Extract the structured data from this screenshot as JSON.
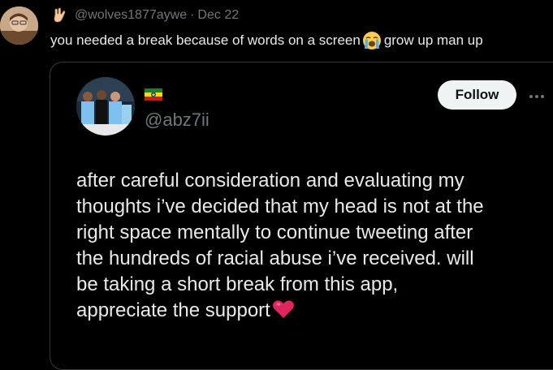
{
  "reply": {
    "avatar": "profile-avatar",
    "badge_icon": "hand-gesture-icon",
    "handle": "@wolves1877aywe",
    "separator": "·",
    "date": "Dec 22",
    "text_before": "you needed a break because of words on a screen",
    "emoji": "loudly-crying-face-icon",
    "text_after": "grow up man up"
  },
  "quote": {
    "avatar": "football-players-avatar",
    "flag_icon": "ethiopia-flag-icon",
    "handle": "@abz7ii",
    "follow_label": "Follow",
    "more_icon": "more-options-icon",
    "text_lines": [
      "after careful consideration and evaluating my",
      "thoughts i’ve decided that my head is not at the",
      "right space mentally to continue tweeting after",
      "the hundreds of racial abuse i’ve received. will",
      "be taking a short break from this app,",
      "appreciate the support"
    ],
    "end_emoji": "red-heart-icon"
  },
  "colors": {
    "background": "#000000",
    "text_primary": "#e7e9ea",
    "text_secondary": "#71767b",
    "border": "#333639",
    "follow_bg": "#eff3f4",
    "heart": "#e0245e"
  }
}
